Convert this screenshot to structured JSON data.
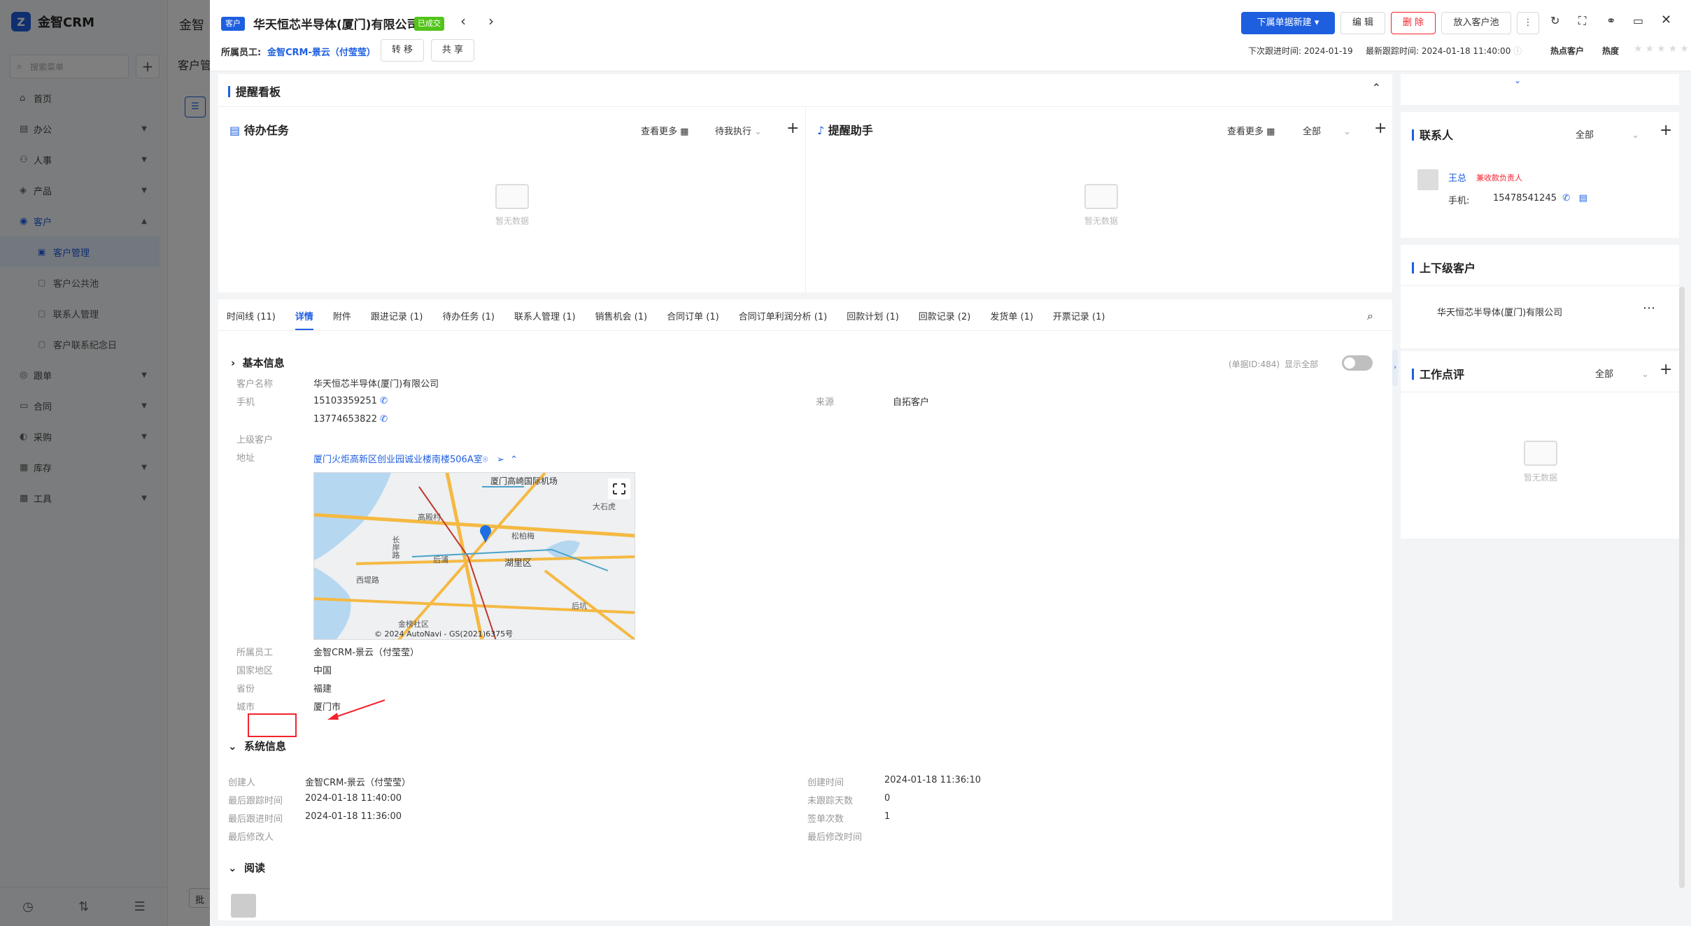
{
  "app": {
    "name": "金智CRM"
  },
  "sidebar": {
    "search_placeholder": "搜索菜单",
    "items": [
      {
        "label": "首页",
        "icon": "home-icon"
      },
      {
        "label": "办公",
        "icon": "office-icon"
      },
      {
        "label": "人事",
        "icon": "people-icon"
      },
      {
        "label": "产品",
        "icon": "product-icon"
      },
      {
        "label": "客户",
        "icon": "customer-icon"
      },
      {
        "label": "跟单",
        "icon": "follow-icon"
      },
      {
        "label": "合同",
        "icon": "contract-icon"
      },
      {
        "label": "采购",
        "icon": "purchase-icon"
      },
      {
        "label": "库存",
        "icon": "stock-icon"
      },
      {
        "label": "工具",
        "icon": "tools-icon"
      }
    ],
    "sub_items": [
      "客户管理",
      "客户公共池",
      "联系人管理",
      "客户联系纪念日"
    ]
  },
  "bg": {
    "title": "金智",
    "subtitle": "客户管",
    "page_btn": "批"
  },
  "header": {
    "cust_tag": "客户",
    "company": "华天恒芯半导体(厦门)有限公司",
    "status": "已成交",
    "owner_label": "所属员工:",
    "owner": "金智CRM-景云（付莹莹）",
    "transfer": "转 移",
    "share": "共 享",
    "new_btn": "下属单据新建",
    "edit": "编 辑",
    "delete": "删 除",
    "to_pool": "放入客户池",
    "next_follow_label": "下次跟进时间:",
    "next_follow": "2024-01-19",
    "last_follow_label": "最新跟踪时间:",
    "last_follow": "2024-01-18 11:40:00",
    "hot_tag": "热点客户",
    "heat_label": "热度",
    "heat_stars": 0
  },
  "board": {
    "title": "提醒看板",
    "todo": {
      "title": "待办任务",
      "more": "查看更多",
      "filter": "待我执行",
      "empty": "暂无数据"
    },
    "helper": {
      "title": "提醒助手",
      "more": "查看更多",
      "filter": "全部",
      "empty": "暂无数据"
    }
  },
  "tabs": [
    "时间线 (11)",
    "详情",
    "附件",
    "跟进记录 (1)",
    "待办任务 (1)",
    "联系人管理 (1)",
    "销售机会 (1)",
    "合同订单 (1)",
    "合同订单利润分析 (1)",
    "回款计划 (1)",
    "回款记录 (2)",
    "发货单 (1)",
    "开票记录 (1)"
  ],
  "basic": {
    "title": "基本信息",
    "doc_id": "(单据ID:484)",
    "show_all": "显示全部",
    "cust_name_label": "客户名称",
    "cust_name": "华天恒芯半导体(厦门)有限公司",
    "phone_label": "手机",
    "phone1": "15103359251",
    "phone2": "13774653822",
    "source_label": "来源",
    "source": "自拓客户",
    "parent_label": "上级客户",
    "addr_label": "地址",
    "addr": "厦门火炬高新区创业园诚业楼南楼506A室",
    "owner_label": "所属员工",
    "owner": "金智CRM-景云（付莹莹）",
    "country_label": "国家地区",
    "country": "中国",
    "province_label": "省份",
    "province": "福建",
    "city_label": "城市",
    "city": "厦门市"
  },
  "map": {
    "labels": [
      "厦门高崎国际机场",
      "高殿村",
      "长岸路",
      "松柏梅",
      "后浦",
      "湖里区",
      "西堤路",
      "后坑",
      "金榜社区",
      "大石虎"
    ],
    "copyright": "© 2024 AutoNavi - GS(2021)6375号"
  },
  "system": {
    "title": "系统信息",
    "creator_label": "创建人",
    "creator": "金智CRM-景云（付莹莹）",
    "create_time_label": "创建时间",
    "create_time": "2024-01-18 11:36:10",
    "last_track_label": "最后跟踪时间",
    "last_track": "2024-01-18 11:40:00",
    "untrack_days_label": "未跟踪天数",
    "untrack_days": "0",
    "last_follow_label": "最后跟进时间",
    "last_follow": "2024-01-18 11:36:00",
    "sign_count_label": "签单次数",
    "sign_count": "1",
    "last_modifier_label": "最后修改人",
    "last_modify_time_label": "最后修改时间"
  },
  "read": {
    "title": "阅读"
  },
  "right": {
    "contacts": {
      "title": "联系人",
      "filter": "全部",
      "name": "王总",
      "role": "兼收款负责人",
      "phone_label": "手机:",
      "phone": "15478541245"
    },
    "hierarchy": {
      "title": "上下级客户",
      "company": "华天恒芯半导体(厦门)有限公司"
    },
    "review": {
      "title": "工作点评",
      "filter": "全部",
      "empty": "暂无数据"
    }
  }
}
